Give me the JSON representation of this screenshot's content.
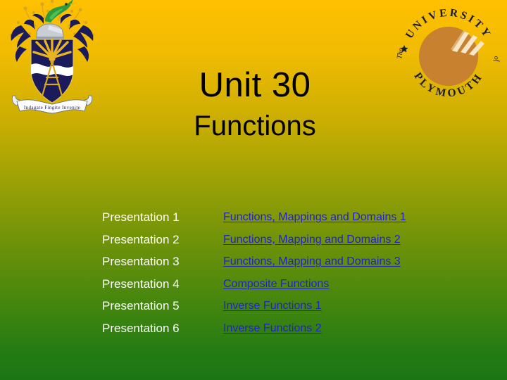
{
  "slide": {
    "title": "Unit 30",
    "subtitle": "Functions",
    "background_top_color": "#FFC000",
    "background_bottom_color": "#1C7514",
    "title_color": "#000000",
    "label_color": "#FFFFFF",
    "link_color": "#2222CC"
  },
  "crest": {
    "name": "university-coat-of-arms",
    "shield_color": "#1B1B5C",
    "ray_color": "#E8B422",
    "wave_color": "#FFFFFF",
    "bird_color": "#2E9B3C",
    "helm_color": "#C9CDD4",
    "banner_color": "#FFFFFF"
  },
  "logo": {
    "name": "university-of-plymouth-logo",
    "top_arc_text": "UNIVERSITY",
    "mid_left_text": "The",
    "mid_right_text": "of",
    "bottom_arc_text": "PLYMOUTH",
    "emblem_color": "#C8812E",
    "stripe_color": "#F7E7C8",
    "text_color": "#1B1B2E"
  },
  "presentations": [
    {
      "label": "Presentation 1",
      "link": "Functions, Mappings and Domains 1"
    },
    {
      "label": "Presentation 2",
      "link": "Functions, Mapping and Domains 2"
    },
    {
      "label": "Presentation 3",
      "link": "Functions, Mapping and Domains 3"
    },
    {
      "label": "Presentation 4",
      "link": "Composite Functions"
    },
    {
      "label": "Presentation 5",
      "link": "Inverse Functions 1"
    },
    {
      "label": "Presentation 6",
      "link": "Inverse Functions 2"
    }
  ]
}
